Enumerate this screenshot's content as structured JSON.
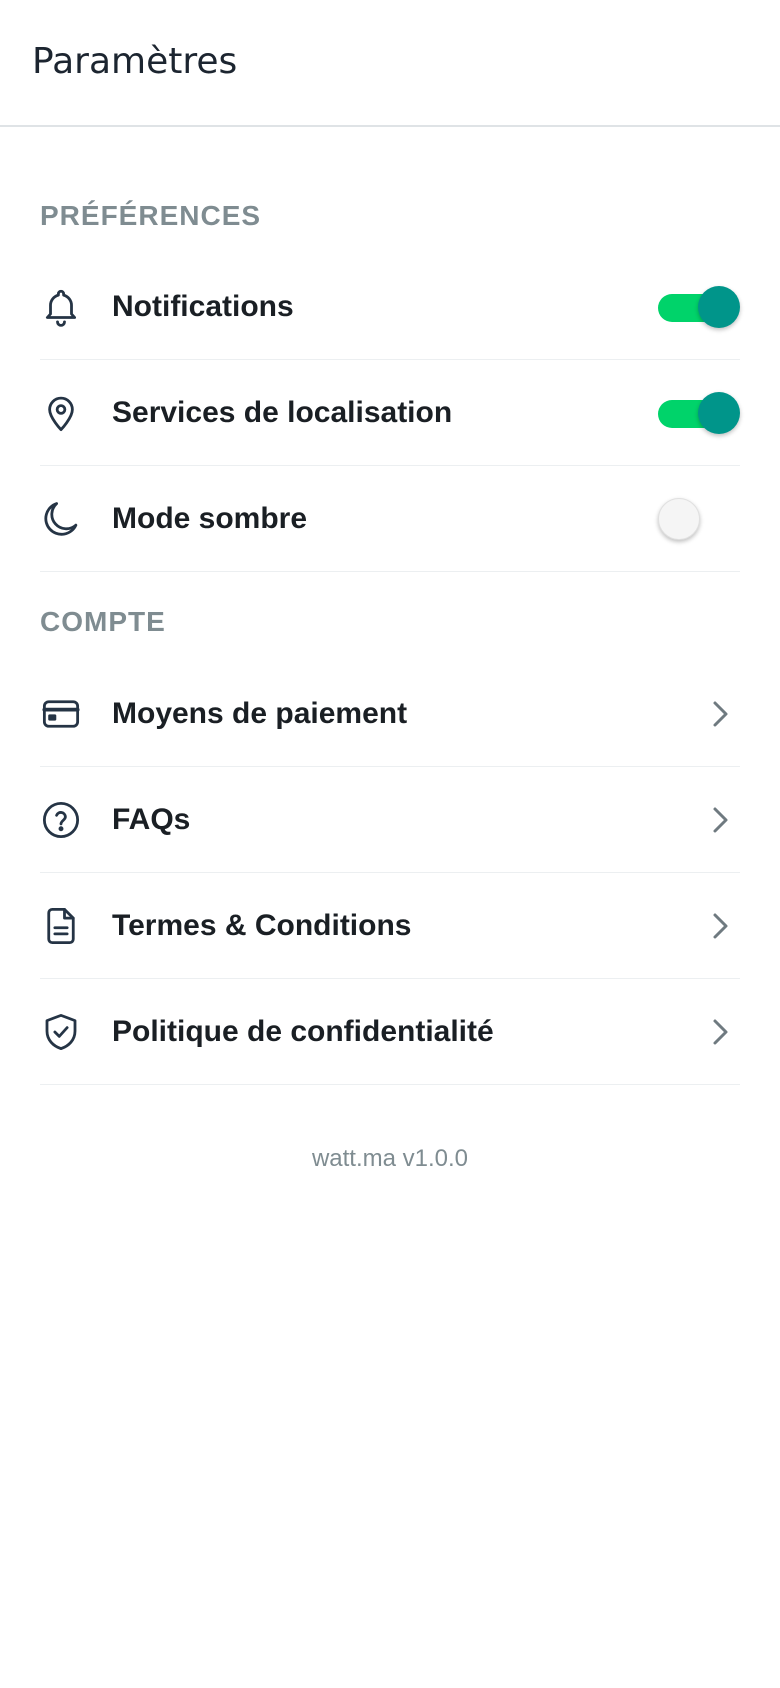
{
  "header": {
    "title": "Paramètres"
  },
  "preferences": {
    "title": "PRÉFÉRENCES",
    "items": [
      {
        "label": "Notifications",
        "icon": "bell-icon",
        "enabled": true
      },
      {
        "label": "Services de localisation",
        "icon": "map-pin-icon",
        "enabled": true
      },
      {
        "label": "Mode sombre",
        "icon": "moon-icon",
        "enabled": false
      }
    ]
  },
  "account": {
    "title": "COMPTE",
    "items": [
      {
        "label": "Moyens de paiement",
        "icon": "credit-card-icon"
      },
      {
        "label": "FAQs",
        "icon": "help-circle-icon"
      },
      {
        "label": "Termes & Conditions",
        "icon": "document-icon"
      },
      {
        "label": "Politique de confidentialité",
        "icon": "shield-check-icon"
      }
    ]
  },
  "footer": {
    "version": "watt.ma v1.0.0"
  },
  "colors": {
    "toggle_track_on": "#00d36a",
    "toggle_knob_on": "#00958a",
    "section_title": "#7f8c91",
    "icon": "#253445"
  }
}
